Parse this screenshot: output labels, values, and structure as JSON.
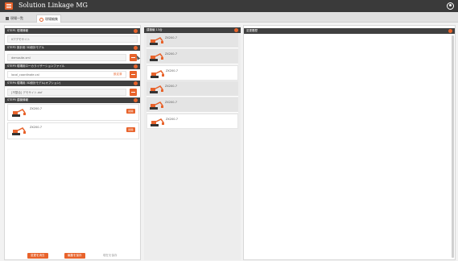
{
  "app": {
    "title": "Solution Linkage MG"
  },
  "tabs": [
    {
      "label": "現場一覧"
    },
    {
      "label": "現場編集"
    }
  ],
  "left_panel": {
    "step1": {
      "header": "STEP1 現場情報",
      "value": "ICTデモサイト"
    },
    "step2": {
      "header": "STEP2 設計用 3D設計モデル",
      "value": "demosite.xml"
    },
    "step3": {
      "header": "STEP3 現場用ローカライザーションファイル",
      "value": "local_coordinate.cal",
      "action": "設定済"
    },
    "step4": {
      "header": "STEP4 現場用 3D設計モデル(オプション)",
      "value": "[不整合] デモサイト.dxf"
    },
    "step5": {
      "header": "STEP5 建機情報",
      "machines": [
        {
          "name": "ZX200-7",
          "button": "削除"
        },
        {
          "name": "ZX200-7",
          "button": "削除"
        }
      ]
    },
    "footer": {
      "btn_cancel": "変更を消去",
      "btn_save": "編集を保存",
      "btn_disabled": "現在を保存"
    }
  },
  "middle_panel": {
    "header": "建機編 13台",
    "machines": [
      {
        "name": "ZX200-7",
        "style": "grey"
      },
      {
        "name": "ZX200-7",
        "style": "grey"
      },
      {
        "name": "ZX200-7",
        "style": "white"
      },
      {
        "name": "ZX200-7",
        "style": "grey"
      },
      {
        "name": "ZX200-7",
        "style": "grey"
      },
      {
        "name": "ZX200-7",
        "style": "white"
      }
    ]
  },
  "right_panel": {
    "header": "変更履歴"
  },
  "colors": {
    "accent": "#e8632b",
    "dark": "#404040",
    "titlebar": "#3a3a3a"
  }
}
